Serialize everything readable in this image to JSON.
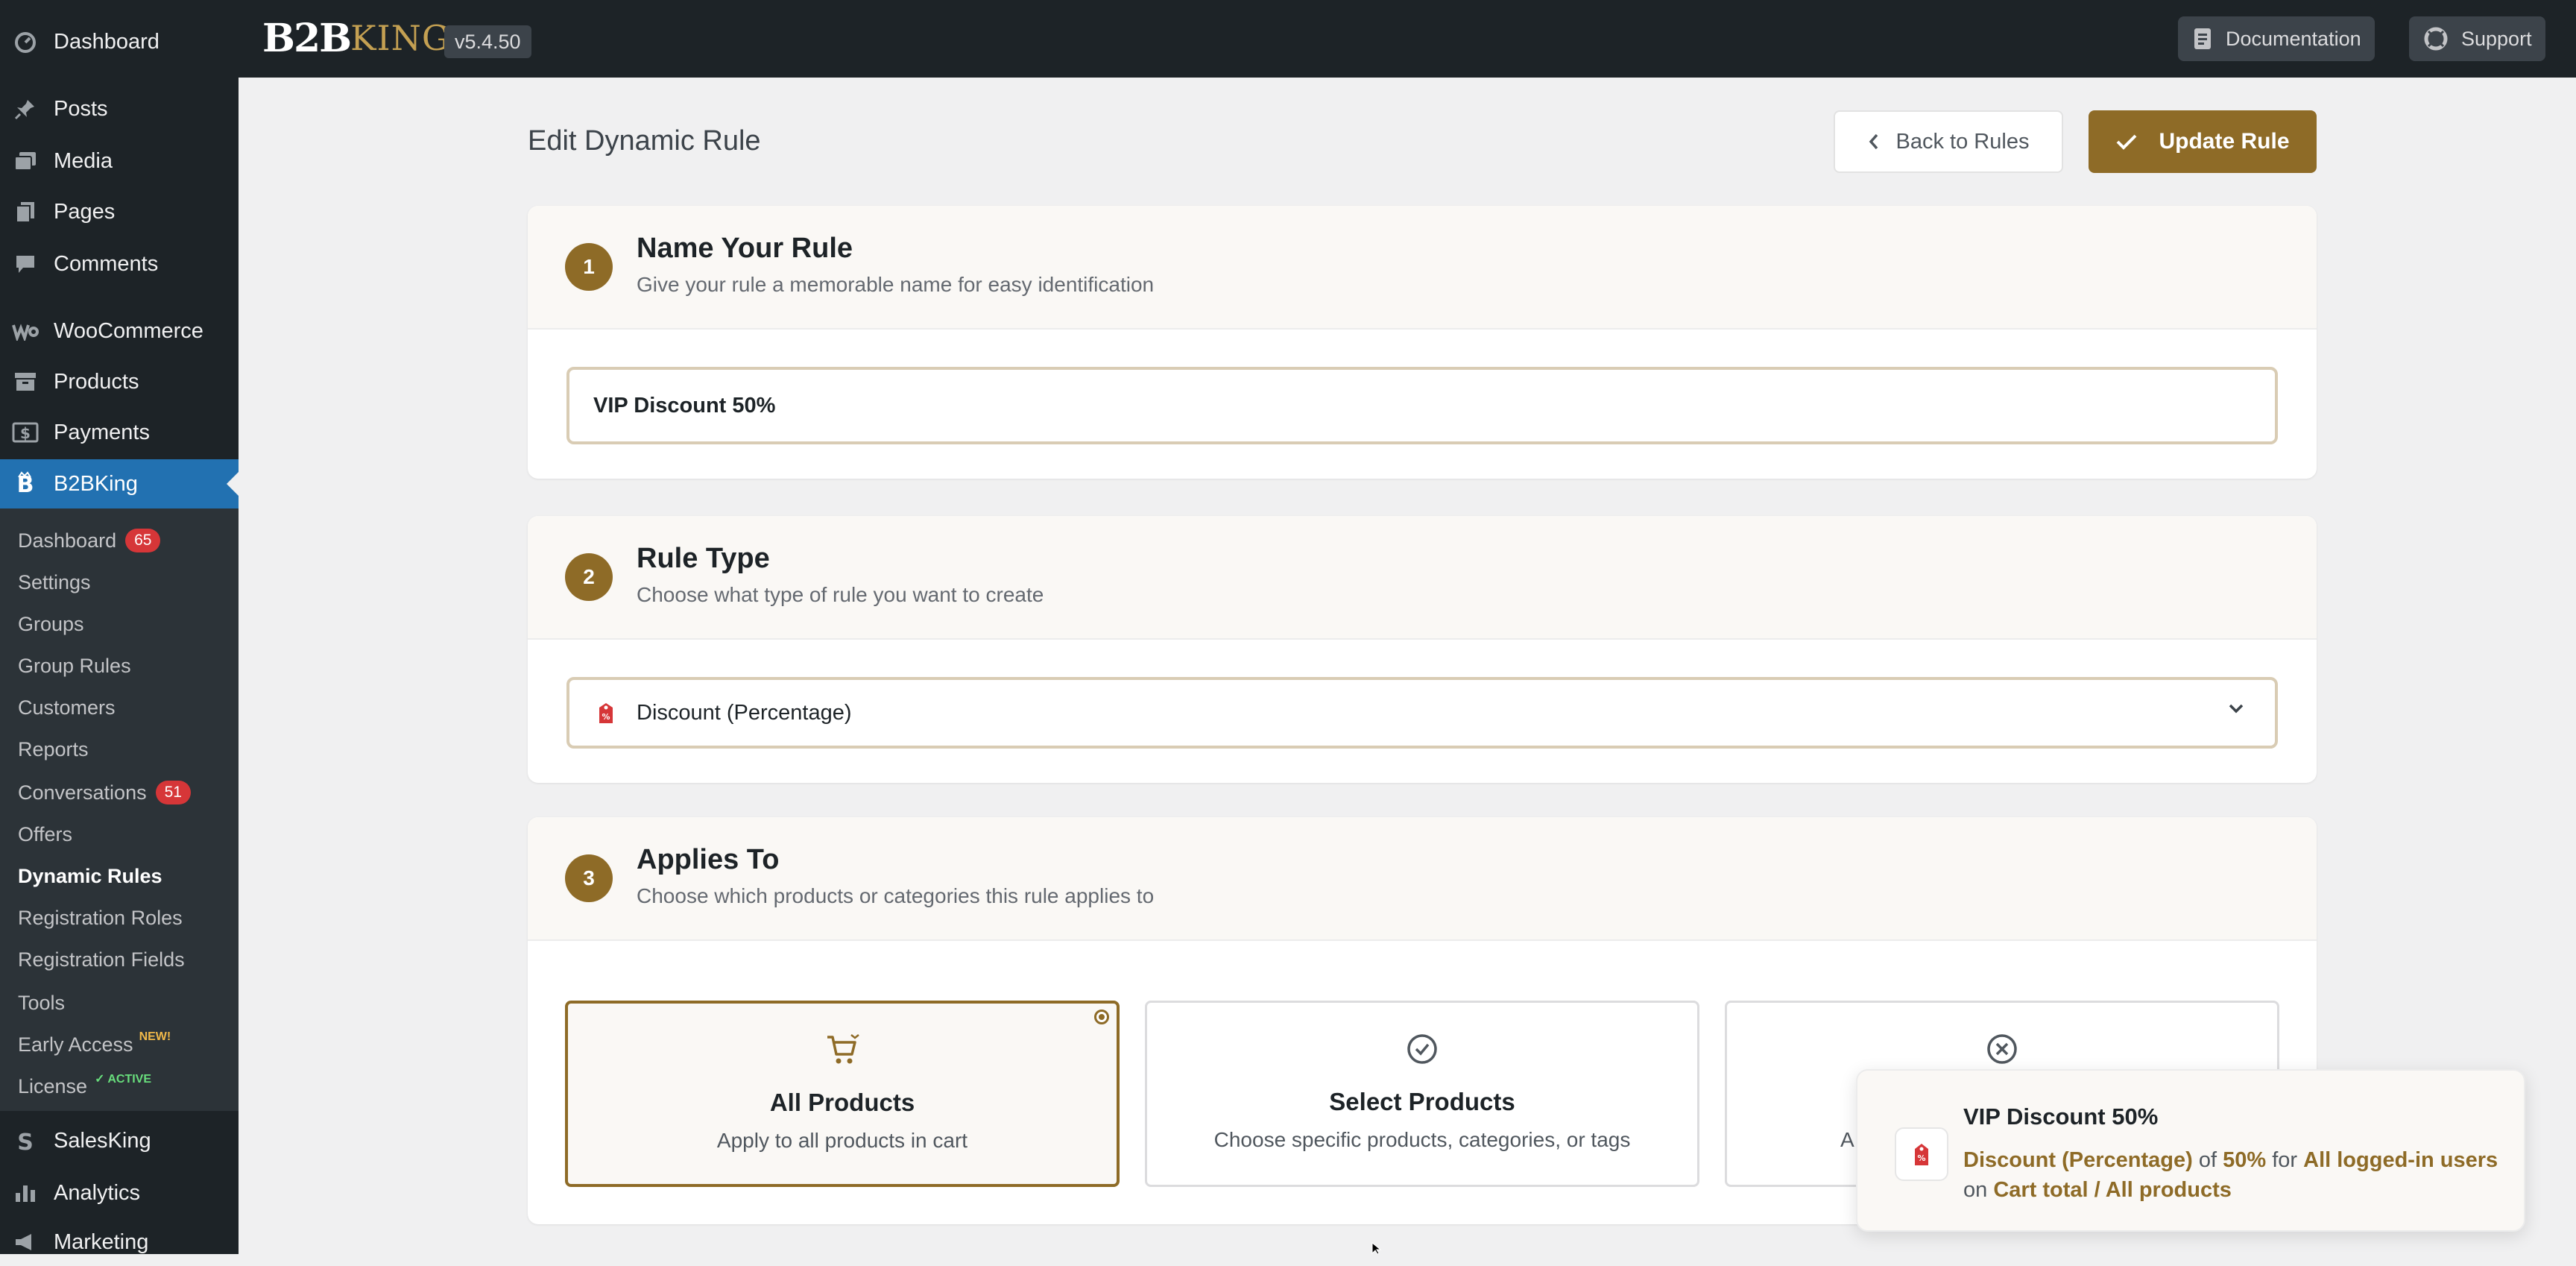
{
  "sidebar": {
    "menu": [
      {
        "label": "Dashboard",
        "icon": "dashboard-icon"
      },
      {
        "label": "Posts",
        "icon": "pushpin-icon"
      },
      {
        "label": "Media",
        "icon": "media-icon"
      },
      {
        "label": "Pages",
        "icon": "pages-icon"
      },
      {
        "label": "Comments",
        "icon": "comment-icon"
      },
      {
        "label": "WooCommerce",
        "icon": "woocommerce-icon"
      },
      {
        "label": "Products",
        "icon": "archive-icon"
      },
      {
        "label": "Payments",
        "icon": "dollar-icon"
      },
      {
        "label": "B2BKing",
        "icon": "b2bking-icon",
        "active": true
      }
    ],
    "submenu": [
      {
        "label": "Dashboard",
        "badge": "65"
      },
      {
        "label": "Settings"
      },
      {
        "label": "Groups"
      },
      {
        "label": "Group Rules"
      },
      {
        "label": "Customers"
      },
      {
        "label": "Reports"
      },
      {
        "label": "Conversations",
        "badge": "51"
      },
      {
        "label": "Offers"
      },
      {
        "label": "Dynamic Rules",
        "current": true
      },
      {
        "label": "Registration Roles"
      },
      {
        "label": "Registration Fields"
      },
      {
        "label": "Tools"
      },
      {
        "label": "Early Access",
        "tag": "NEW!"
      },
      {
        "label": "License",
        "tag": "✓ ACTIVE"
      }
    ],
    "menu_after": [
      {
        "label": "SalesKing",
        "icon": "salesking-icon"
      },
      {
        "label": "Analytics",
        "icon": "bar-chart-icon"
      },
      {
        "label": "Marketing",
        "icon": "megaphone-icon"
      }
    ]
  },
  "topbar": {
    "logo_b2b": "B2B",
    "logo_king": "KING",
    "version": "v5.4.50",
    "documentation_label": "Documentation",
    "support_label": "Support"
  },
  "header": {
    "page_title": "Edit Dynamic Rule",
    "back_label": "Back to Rules",
    "update_label": "Update Rule"
  },
  "steps": {
    "name": {
      "number": "1",
      "title": "Name Your Rule",
      "subtitle": "Give your rule a memorable name for easy identification",
      "value": "VIP Discount 50%"
    },
    "type": {
      "number": "2",
      "title": "Rule Type",
      "subtitle": "Choose what type of rule you want to create",
      "selected": "Discount (Percentage)"
    },
    "applies": {
      "number": "3",
      "title": "Applies To",
      "subtitle": "Choose which products or categories this rule applies to",
      "options": [
        {
          "title": "All Products",
          "desc": "Apply to all products in cart",
          "icon": "cart-icon",
          "selected": true
        },
        {
          "title": "Select Products",
          "desc": "Choose specific products, categories, or tags",
          "icon": "check-circle-icon",
          "selected": false
        },
        {
          "title": "",
          "desc": "A",
          "icon": "x-circle-icon",
          "selected": false
        }
      ]
    }
  },
  "toast": {
    "title": "VIP Discount 50%",
    "type": "Discount (Percentage)",
    "of": "of",
    "amount": "50%",
    "for": "for",
    "who": "All logged-in users",
    "on": "on",
    "target": "Cart total / All products"
  },
  "colors": {
    "accent": "#8e6b27",
    "sidebar_bg": "#1d2327",
    "sidebar_active": "#2271b1",
    "badge": "#d63638"
  }
}
